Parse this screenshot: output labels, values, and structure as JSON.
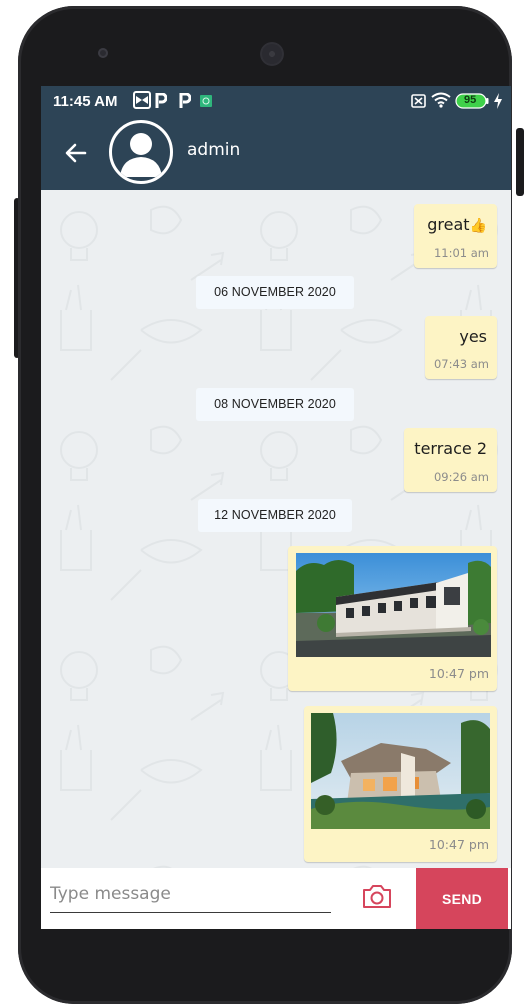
{
  "status_bar": {
    "time": "11:45 AM",
    "battery": "95"
  },
  "header": {
    "contact_name": "admin"
  },
  "messages": [
    {
      "type": "text",
      "text": "great",
      "emoji": "👍",
      "time": "11:01 am"
    },
    {
      "type": "date",
      "label": "06 NOVEMBER 2020"
    },
    {
      "type": "text",
      "text": "yes",
      "time": "07:43 am"
    },
    {
      "type": "date",
      "label": "08 NOVEMBER 2020"
    },
    {
      "type": "text",
      "text": "terrace 2",
      "time": "09:26 am"
    },
    {
      "type": "date",
      "label": "12 NOVEMBER 2020"
    },
    {
      "type": "image",
      "time": "10:47 pm"
    },
    {
      "type": "image",
      "time": "10:47 pm"
    }
  ],
  "composer": {
    "placeholder": "Type message",
    "send_label": "SEND"
  },
  "colors": {
    "header": "#2d4456",
    "bubble": "#fdf4c5",
    "send_button": "#d6455c",
    "chat_background": "#eceff1"
  }
}
